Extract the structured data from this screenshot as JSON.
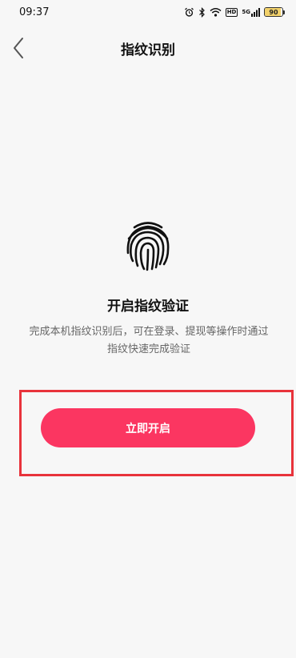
{
  "status_bar": {
    "time": "09:37",
    "icons": [
      "alarm-icon",
      "bluetooth-icon",
      "wifi-icon",
      "hd-icon",
      "5g-signal-icon",
      "battery-icon"
    ],
    "hd_label": "HD",
    "network_label": "5G",
    "battery_level": 90,
    "battery_text": "90"
  },
  "nav": {
    "title": "指纹识别",
    "back_icon": "chevron-left-icon"
  },
  "main": {
    "icon": "fingerprint-icon",
    "heading": "开启指纹验证",
    "description": "完成本机指纹识别后，可在登录、提现等操作时通过指纹快速完成验证",
    "button_label": "立即开启"
  },
  "colors": {
    "primary": "#fb3661",
    "highlight_border": "#e8333b",
    "background": "#f7f7f7"
  }
}
